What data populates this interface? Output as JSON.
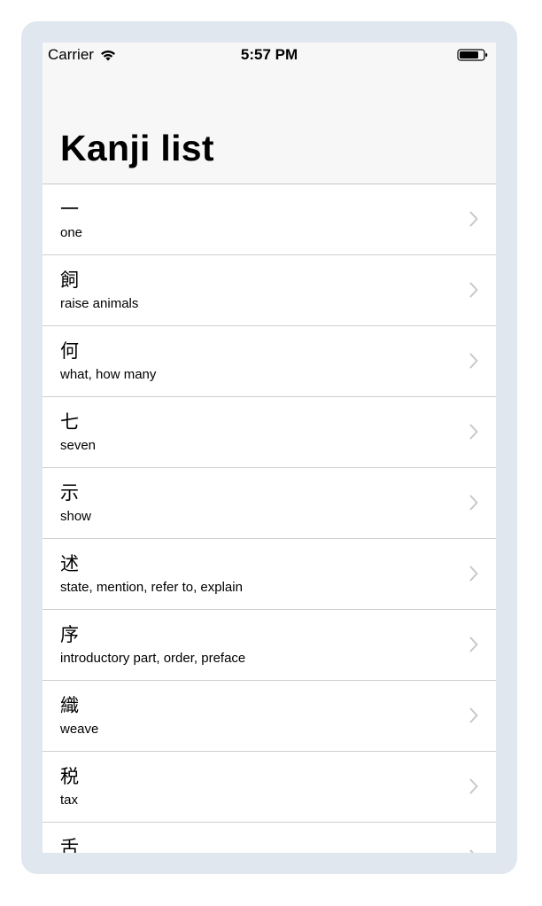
{
  "status_bar": {
    "carrier": "Carrier",
    "time": "5:57 PM",
    "icons": [
      "wifi-icon",
      "battery-icon"
    ]
  },
  "navigation": {
    "title": "Kanji list"
  },
  "kanji_list": [
    {
      "kanji": "一",
      "meaning": "one"
    },
    {
      "kanji": "飼",
      "meaning": "raise animals"
    },
    {
      "kanji": "何",
      "meaning": "what, how many"
    },
    {
      "kanji": "七",
      "meaning": "seven"
    },
    {
      "kanji": "示",
      "meaning": "show"
    },
    {
      "kanji": "述",
      "meaning": "state, mention, refer to, explain"
    },
    {
      "kanji": "序",
      "meaning": "introductory part, order, preface"
    },
    {
      "kanji": "織",
      "meaning": "weave"
    },
    {
      "kanji": "税",
      "meaning": "tax"
    },
    {
      "kanji": "舌",
      "meaning": ""
    }
  ],
  "colors": {
    "frame": "#e1e7ef",
    "navbar": "#f7f7f7",
    "separator": "#cfcfd3",
    "chevron": "#c7c7cc"
  }
}
